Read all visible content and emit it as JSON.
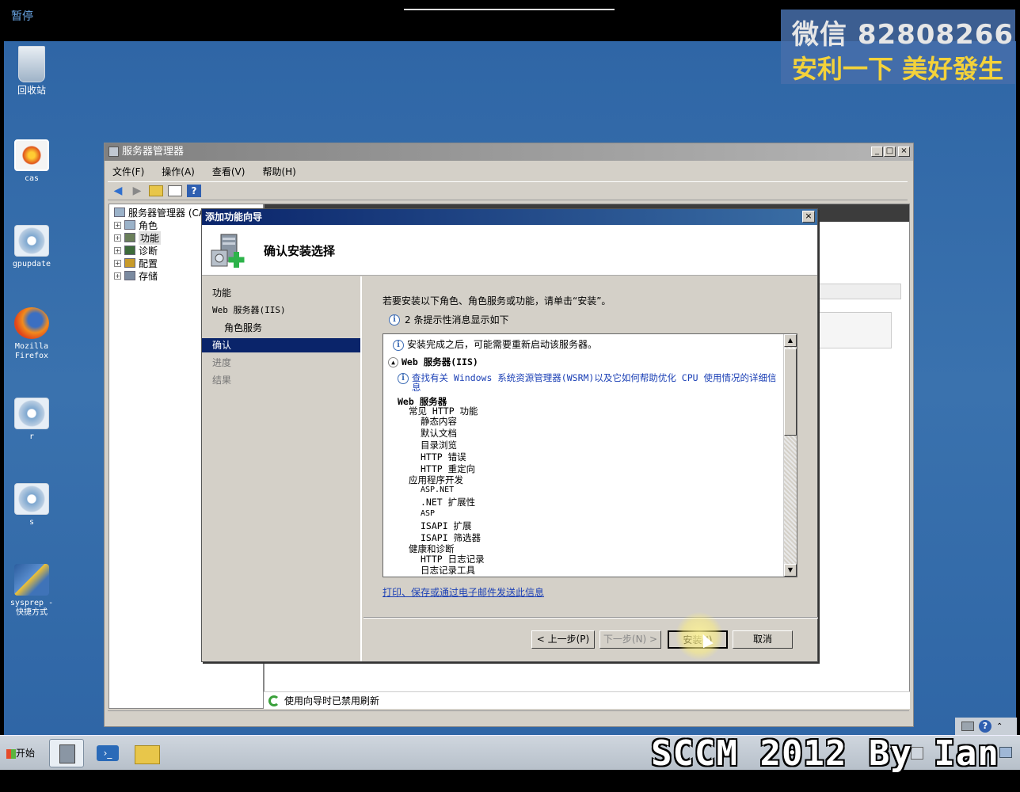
{
  "screen": {
    "pause_label": "暂停"
  },
  "watermark": {
    "line1": "微信 82808266",
    "line2": "安利一下 美好發生",
    "bottom": "SCCM 2012 By Ian"
  },
  "desktop_icons": [
    {
      "label": "回收站",
      "icon": "recycle-bin-icon"
    },
    {
      "label": "cas",
      "icon": "flower-image-icon"
    },
    {
      "label": "gpupdate",
      "icon": "gear-shortcut-icon"
    },
    {
      "label": "Mozilla Firefox",
      "icon": "firefox-icon"
    },
    {
      "label": "r",
      "icon": "gear-shortcut-icon"
    },
    {
      "label": "s",
      "icon": "gear-shortcut-icon"
    },
    {
      "label": "sysprep - 快捷方式",
      "icon": "network-shortcut-icon"
    }
  ],
  "server_manager": {
    "title": "服务器管理器",
    "menu": [
      "文件(F)",
      "操作(A)",
      "查看(V)",
      "帮助(H)"
    ],
    "tree_root": "服务器管理器 (CAS)",
    "tree_items": [
      "角色",
      "功能",
      "诊断",
      "配置",
      "存储"
    ],
    "status_text": "使用向导时已禁用刷新"
  },
  "wizard": {
    "title": "添加功能向导",
    "heading": "确认安装选择",
    "nav": [
      {
        "label": "功能",
        "state": "normal"
      },
      {
        "label": "Web 服务器(IIS)",
        "state": "normal"
      },
      {
        "label": "角色服务",
        "state": "sub"
      },
      {
        "label": "确认",
        "state": "active"
      },
      {
        "label": "进度",
        "state": "disabled"
      },
      {
        "label": "结果",
        "state": "disabled"
      }
    ],
    "intro": "若要安装以下角色、角色服务或功能，请单击“安装”。",
    "info_count": "2 条提示性消息显示如下",
    "list": {
      "restart_note": "安装完成之后，可能需要重新启动该服务器。",
      "section_header": "Web 服务器(IIS)",
      "wsrm_link_line1": "查找有关 Windows 系统资源管理器(WSRM)以及它如何帮助优化 CPU 使用情况的详细信",
      "wsrm_link_line2": "息",
      "group_title": "Web 服务器",
      "subgroups": [
        {
          "title": "常见 HTTP 功能",
          "items": [
            "静态内容",
            "默认文档",
            "目录浏览",
            "HTTP 错误",
            "HTTP 重定向"
          ]
        },
        {
          "title": "应用程序开发",
          "items": [
            "ASP.NET",
            ".NET 扩展性",
            "ASP",
            "ISAPI 扩展",
            "ISAPI 筛选器"
          ]
        },
        {
          "title": "健康和诊断",
          "items": [
            "HTTP 日志记录",
            "日志记录工具"
          ]
        }
      ]
    },
    "print_link": "打印、保存或通过电子邮件发送此信息",
    "buttons": {
      "back": "< 上一步(P)",
      "next": "下一步(N) >",
      "install": "安装(I)",
      "cancel": "取消"
    }
  },
  "taskbar": {
    "start": "开始"
  }
}
